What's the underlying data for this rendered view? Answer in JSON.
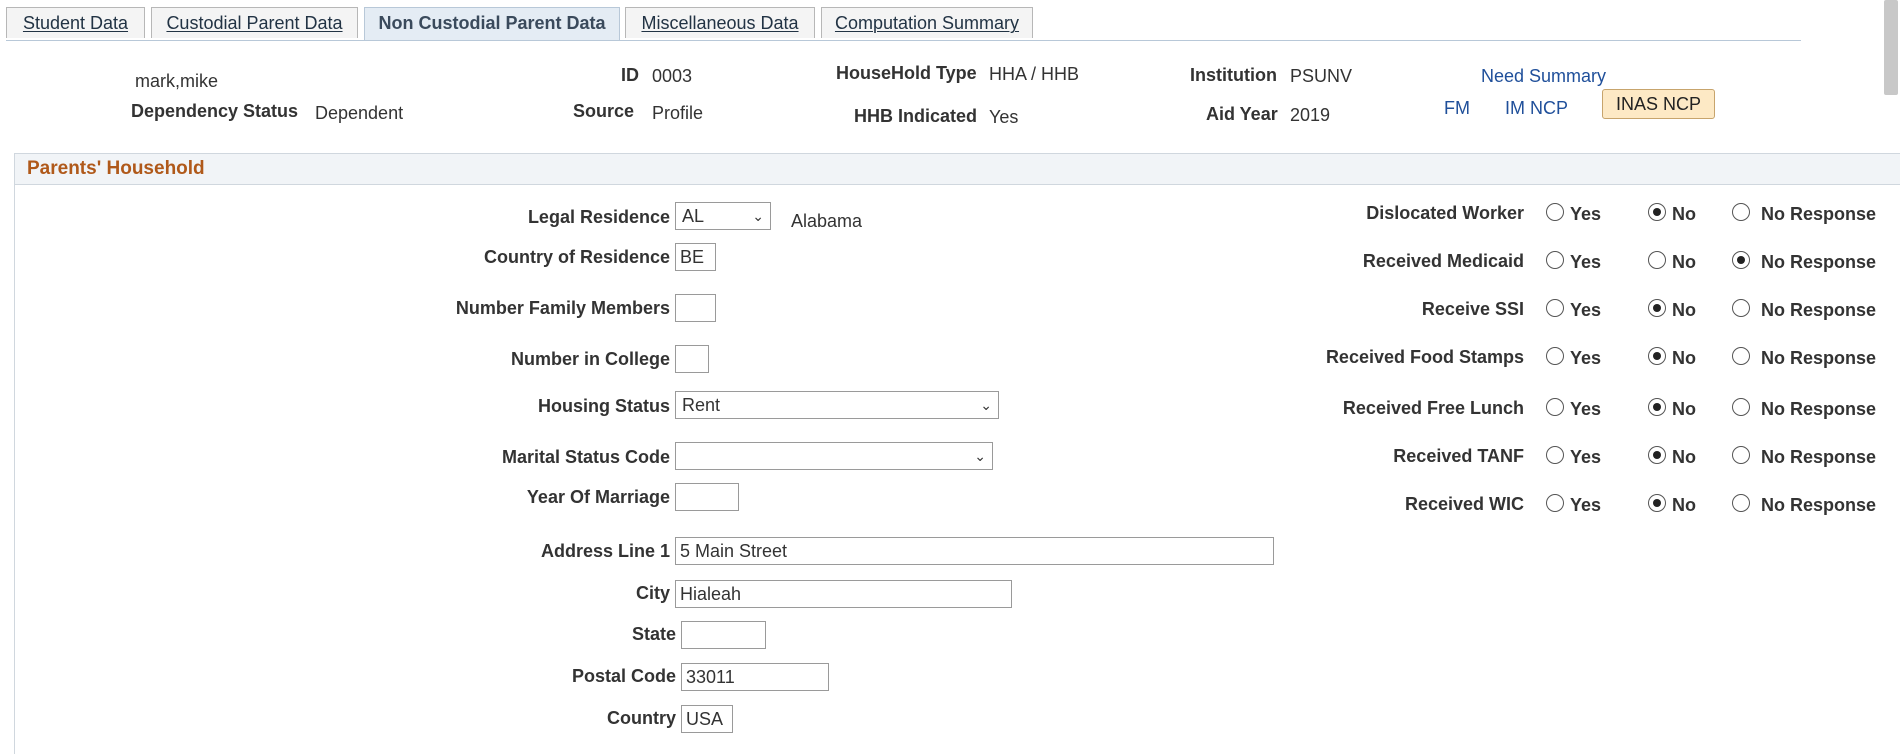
{
  "tabs": [
    {
      "label": "Student Data",
      "active": false
    },
    {
      "label": "Custodial Parent Data",
      "active": false
    },
    {
      "label": "Non Custodial Parent Data",
      "active": true
    },
    {
      "label": "Miscellaneous Data",
      "active": false
    },
    {
      "label": "Computation Summary",
      "active": false
    }
  ],
  "header": {
    "name": "mark,mike",
    "dependency_status_label": "Dependency Status",
    "dependency_status": "Dependent",
    "id_label": "ID",
    "id": "0003",
    "source_label": "Source",
    "source": "Profile",
    "household_type_label": "HouseHold Type",
    "household_type": "HHA / HHB",
    "hhb_indicated_label": "HHB Indicated",
    "hhb_indicated": "Yes",
    "institution_label": "Institution",
    "institution": "PSUNV",
    "aid_year_label": "Aid Year",
    "aid_year": "2019",
    "need_summary_link": "Need Summary",
    "fm_link": "FM",
    "im_ncp_link": "IM NCP",
    "inas_ncp_button": "INAS NCP"
  },
  "section": {
    "title": "Parents' Household",
    "fields": {
      "legal_residence": {
        "label": "Legal Residence",
        "value": "AL",
        "description": "Alabama"
      },
      "country_of_residence": {
        "label": "Country of Residence",
        "value": "BE"
      },
      "number_family_members": {
        "label": "Number Family Members",
        "value": ""
      },
      "number_in_college": {
        "label": "Number in College",
        "value": ""
      },
      "housing_status": {
        "label": "Housing Status",
        "value": "Rent"
      },
      "marital_status_code": {
        "label": "Marital Status Code",
        "value": ""
      },
      "year_of_marriage": {
        "label": "Year Of Marriage",
        "value": ""
      },
      "address_line_1": {
        "label": "Address Line 1",
        "value": "5 Main Street"
      },
      "city": {
        "label": "City",
        "value": "Hialeah"
      },
      "state": {
        "label": "State",
        "value": ""
      },
      "postal_code": {
        "label": "Postal Code",
        "value": "33011"
      },
      "country": {
        "label": "Country",
        "value": "USA"
      }
    },
    "radio_options": {
      "yes": "Yes",
      "no": "No",
      "no_response": "No Response"
    },
    "radio_groups": [
      {
        "label": "Dislocated Worker",
        "selected": "no"
      },
      {
        "label": "Received Medicaid",
        "selected": "no_response"
      },
      {
        "label": "Receive SSI",
        "selected": "no"
      },
      {
        "label": "Received Food Stamps",
        "selected": "no"
      },
      {
        "label": "Received Free Lunch",
        "selected": "no"
      },
      {
        "label": "Received TANF",
        "selected": "no"
      },
      {
        "label": "Received WIC",
        "selected": "no"
      }
    ]
  }
}
